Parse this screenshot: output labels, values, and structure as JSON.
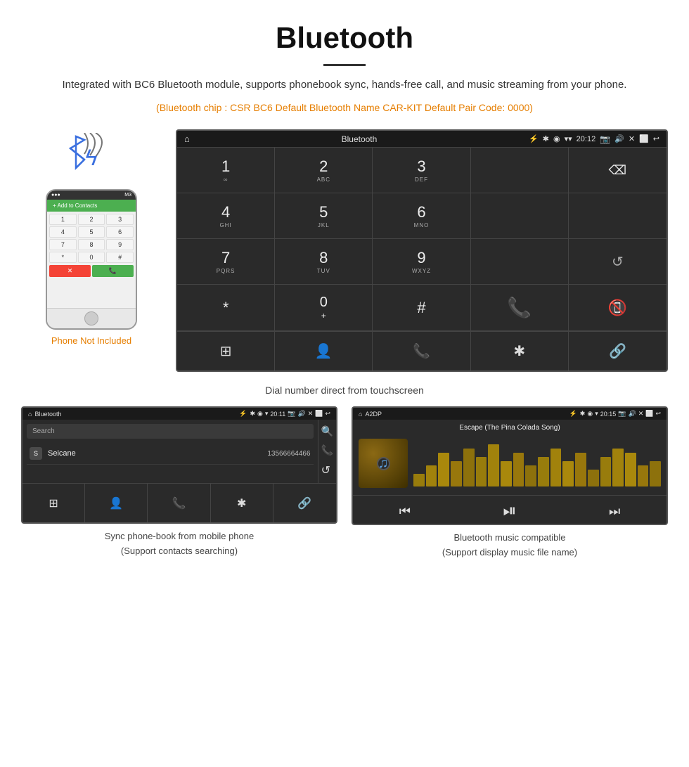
{
  "page": {
    "title": "Bluetooth",
    "subtitle": "Integrated with BC6 Bluetooth module, supports phonebook sync, hands-free call, and music streaming from your phone.",
    "spec_line": "(Bluetooth chip : CSR BC6    Default Bluetooth Name CAR-KIT    Default Pair Code: 0000)",
    "caption_main": "Dial number direct from touchscreen",
    "phone_not_included": "Phone Not Included"
  },
  "car_screen": {
    "home_icon": "⌂",
    "screen_title": "Bluetooth",
    "usb_icon": "⚡",
    "bt_icon": "✱",
    "location_icon": "◉",
    "signal_icon": "▾",
    "time": "20:12",
    "camera_icon": "📷",
    "volume_icon": "🔊",
    "close_icon": "✕",
    "window_icon": "⬜",
    "back_icon": "↩",
    "keys": [
      {
        "row": 0,
        "cells": [
          {
            "label": "1",
            "sub": "∞",
            "type": "digit"
          },
          {
            "label": "2",
            "sub": "ABC",
            "type": "digit"
          },
          {
            "label": "3",
            "sub": "DEF",
            "type": "digit"
          },
          {
            "label": "",
            "sub": "",
            "type": "empty"
          },
          {
            "label": "⌫",
            "sub": "",
            "type": "backspace"
          }
        ]
      },
      {
        "row": 1,
        "cells": [
          {
            "label": "4",
            "sub": "GHI",
            "type": "digit"
          },
          {
            "label": "5",
            "sub": "JKL",
            "type": "digit"
          },
          {
            "label": "6",
            "sub": "MNO",
            "type": "digit"
          },
          {
            "label": "",
            "sub": "",
            "type": "empty"
          },
          {
            "label": "",
            "sub": "",
            "type": "empty"
          }
        ]
      },
      {
        "row": 2,
        "cells": [
          {
            "label": "7",
            "sub": "PQRS",
            "type": "digit"
          },
          {
            "label": "8",
            "sub": "TUV",
            "type": "digit"
          },
          {
            "label": "9",
            "sub": "WXYZ",
            "type": "digit"
          },
          {
            "label": "",
            "sub": "",
            "type": "empty"
          },
          {
            "label": "↺",
            "sub": "",
            "type": "refresh"
          }
        ]
      },
      {
        "row": 3,
        "cells": [
          {
            "label": "*",
            "sub": "",
            "type": "symbol"
          },
          {
            "label": "0",
            "sub": "+",
            "type": "zero"
          },
          {
            "label": "#",
            "sub": "",
            "type": "symbol"
          },
          {
            "label": "📞",
            "sub": "",
            "type": "call-green"
          },
          {
            "label": "📵",
            "sub": "",
            "type": "call-red"
          }
        ]
      }
    ],
    "bottom_icons": [
      "⊞",
      "👤",
      "📞",
      "✱",
      "🔗"
    ]
  },
  "phonebook_screen": {
    "title": "Bluetooth",
    "time": "20:11",
    "search_placeholder": "Search",
    "contacts": [
      {
        "letter": "S",
        "name": "Seicane",
        "number": "13566664466"
      }
    ],
    "side_icons": [
      "🔍",
      "📞",
      "↺"
    ],
    "bottom_icons": [
      "⊞",
      "👤",
      "📞",
      "✱",
      "🔗"
    ],
    "caption": "Sync phone-book from mobile phone\n(Support contacts searching)"
  },
  "music_screen": {
    "title": "A2DP",
    "time": "20:15",
    "song_title": "Escape (The Pina Colada Song)",
    "eq_bars": [
      3,
      5,
      8,
      6,
      9,
      7,
      10,
      6,
      8,
      5,
      7,
      9,
      6,
      8,
      4,
      7,
      9,
      8,
      5,
      6
    ],
    "controls": [
      "⏮",
      "⏯",
      "⏭"
    ],
    "caption": "Bluetooth music compatible\n(Support display music file name)"
  }
}
